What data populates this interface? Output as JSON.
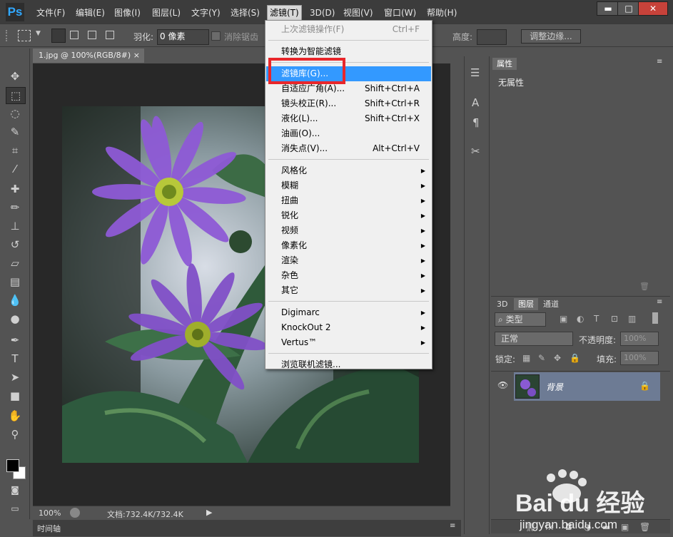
{
  "app": {
    "logo": "Ps"
  },
  "menubar": {
    "items": [
      "文件(F)",
      "编辑(E)",
      "图像(I)",
      "图层(L)",
      "文字(Y)",
      "选择(S)",
      "滤镜(T)",
      "3D(D)",
      "视图(V)",
      "窗口(W)",
      "帮助(H)"
    ],
    "active_index": 6
  },
  "window_controls": {
    "minimize": "▬",
    "maximize": "□",
    "close": "✕"
  },
  "options_bar": {
    "feather_label": "羽化:",
    "feather_value": "0 像素",
    "antialias_label": "消除锯齿",
    "height_label": "高度:",
    "refine_edge": "调整边缘..."
  },
  "document": {
    "tab_title": "1.jpg @ 100%(RGB/8#)",
    "tab_close": "×"
  },
  "statusbar": {
    "zoom": "100%",
    "info": "文档:732.4K/732.4K"
  },
  "timeline": {
    "label": "时间轴"
  },
  "properties": {
    "tab": "属性",
    "content": "无属性"
  },
  "layers": {
    "tabs": [
      "3D",
      "图层",
      "通道"
    ],
    "filter_kind": "类型",
    "blend_mode": "正常",
    "opacity_label": "不透明度:",
    "opacity_value": "100%",
    "lock_label": "锁定:",
    "fill_label": "填充:",
    "fill_value": "100%",
    "layer_name": "背景"
  },
  "filter_menu": {
    "items": [
      {
        "label": "上次滤镜操作(F)",
        "shortcut": "Ctrl+F",
        "disabled": true
      },
      {
        "sep": true
      },
      {
        "label": "转换为智能滤镜"
      },
      {
        "sep": true
      },
      {
        "label": "滤镜库(G)...",
        "highlighted": true
      },
      {
        "label": "自适应广角(A)...",
        "shortcut": "Shift+Ctrl+A"
      },
      {
        "label": "镜头校正(R)...",
        "shortcut": "Shift+Ctrl+R"
      },
      {
        "label": "液化(L)...",
        "shortcut": "Shift+Ctrl+X"
      },
      {
        "label": "油画(O)..."
      },
      {
        "label": "消失点(V)...",
        "shortcut": "Alt+Ctrl+V"
      },
      {
        "sep": true
      },
      {
        "label": "风格化",
        "submenu": true
      },
      {
        "label": "模糊",
        "submenu": true
      },
      {
        "label": "扭曲",
        "submenu": true
      },
      {
        "label": "锐化",
        "submenu": true
      },
      {
        "label": "视频",
        "submenu": true
      },
      {
        "label": "像素化",
        "submenu": true
      },
      {
        "label": "渲染",
        "submenu": true
      },
      {
        "label": "杂色",
        "submenu": true
      },
      {
        "label": "其它",
        "submenu": true
      },
      {
        "sep": true
      },
      {
        "label": "Digimarc",
        "submenu": true
      },
      {
        "label": "KnockOut 2",
        "submenu": true
      },
      {
        "label": "Vertus™",
        "submenu": true
      },
      {
        "sep": true
      },
      {
        "label": "浏览联机滤镜..."
      }
    ]
  },
  "watermark": {
    "brand": "Bai du 经验",
    "url": "jingyan.baidu.com"
  },
  "colors": {
    "accent": "#3399ff",
    "annotation": "#e8262a"
  }
}
